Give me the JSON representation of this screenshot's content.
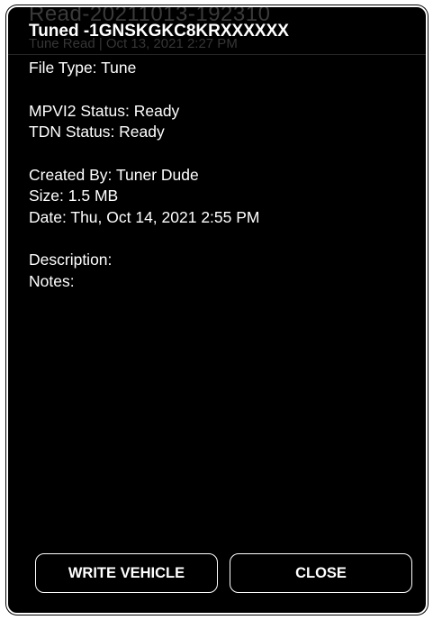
{
  "background": {
    "title": "Read-20211013-192310",
    "subtitle": "Tune Read | Oct 13, 2021 2:27 PM"
  },
  "dialog": {
    "title": "Tuned -1GNSKGKC8KRXXXXXX",
    "file_type": "File Type: Tune",
    "mpvi2_status": "MPVI2 Status: Ready",
    "tdn_status": "TDN Status: Ready",
    "created_by": "Created By: Tuner Dude",
    "size": "Size: 1.5 MB",
    "date": "Date: Thu, Oct 14, 2021 2:55 PM",
    "description": "Description:",
    "notes": "Notes:"
  },
  "buttons": {
    "write_vehicle": "WRITE VEHICLE",
    "close": "CLOSE"
  },
  "colors": {
    "dialog_bg": "#000000",
    "text": "#ffffff",
    "border": "#ffffff"
  }
}
